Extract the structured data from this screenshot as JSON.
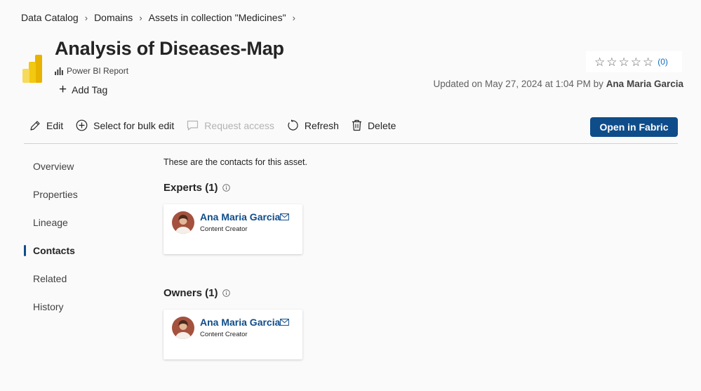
{
  "breadcrumb": [
    "Data Catalog",
    "Domains",
    "Assets in collection \"Medicines\""
  ],
  "asset": {
    "title": "Analysis of Diseases-Map",
    "type": "Power BI Report",
    "add_tag": "Add Tag"
  },
  "rating": {
    "stars": 5,
    "count": "(0)"
  },
  "updated": {
    "prefix": "Updated on May 27, 2024 at 1:04 PM by",
    "user": "Ana Maria Garcia"
  },
  "toolbar": {
    "edit": "Edit",
    "bulk_edit": "Select for bulk edit",
    "request_access": "Request access",
    "refresh": "Refresh",
    "delete": "Delete",
    "open_fabric": "Open in Fabric"
  },
  "nav": [
    "Overview",
    "Properties",
    "Lineage",
    "Contacts",
    "Related",
    "History"
  ],
  "nav_active": "Contacts",
  "contacts": {
    "intro": "These are the contacts for this asset.",
    "experts": {
      "title": "Experts (1)",
      "people": [
        {
          "name": "Ana Maria Garcia",
          "role": "Content Creator"
        }
      ]
    },
    "owners": {
      "title": "Owners (1)",
      "people": [
        {
          "name": "Ana Maria Garcia",
          "role": "Content Creator"
        }
      ]
    }
  },
  "colors": {
    "accent": "#0f4c8a",
    "link": "#0f6cbd",
    "powerbi_yellow": "#f2c811"
  }
}
